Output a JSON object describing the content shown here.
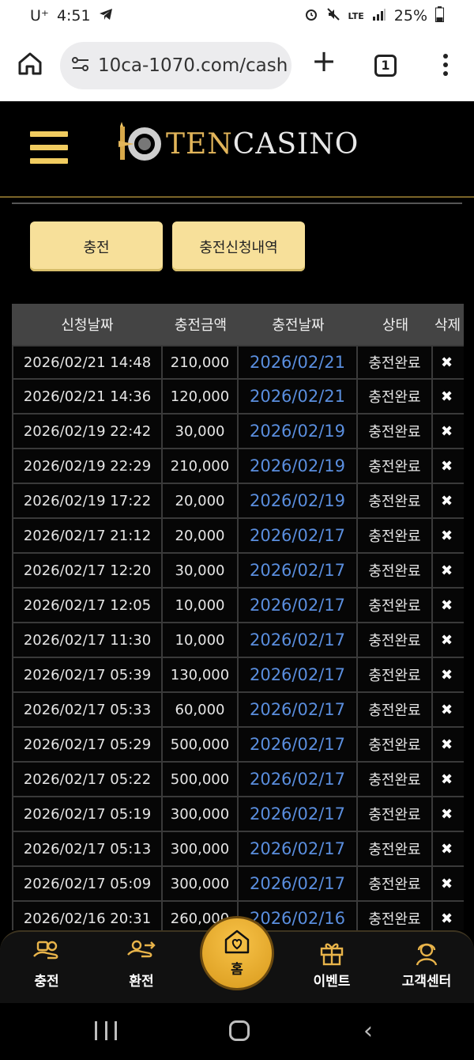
{
  "status_bar": {
    "carrier": "U⁺",
    "time": "4:51",
    "network": "LTE",
    "battery": "25%"
  },
  "browser": {
    "url": "10ca-1070.com/cash",
    "tab_count": "1"
  },
  "site": {
    "logo_ten": "TEN",
    "logo_casino": "CASINO"
  },
  "tabs": {
    "charge": "충전",
    "history": "충전신청내역"
  },
  "table": {
    "headers": [
      "신청날짜",
      "충전금액",
      "충전날짜",
      "상태",
      "삭제"
    ],
    "rows": [
      [
        "2026/02/21 14:48",
        "210,000",
        "2026/02/21",
        "충전완료",
        "✖"
      ],
      [
        "2026/02/21 14:36",
        "120,000",
        "2026/02/21",
        "충전완료",
        "✖"
      ],
      [
        "2026/02/19 22:42",
        "30,000",
        "2026/02/19",
        "충전완료",
        "✖"
      ],
      [
        "2026/02/19 22:29",
        "210,000",
        "2026/02/19",
        "충전완료",
        "✖"
      ],
      [
        "2026/02/19 17:22",
        "20,000",
        "2026/02/19",
        "충전완료",
        "✖"
      ],
      [
        "2026/02/17 21:12",
        "20,000",
        "2026/02/17",
        "충전완료",
        "✖"
      ],
      [
        "2026/02/17 12:20",
        "30,000",
        "2026/02/17",
        "충전완료",
        "✖"
      ],
      [
        "2026/02/17 12:05",
        "10,000",
        "2026/02/17",
        "충전완료",
        "✖"
      ],
      [
        "2026/02/17 11:30",
        "10,000",
        "2026/02/17",
        "충전완료",
        "✖"
      ],
      [
        "2026/02/17 05:39",
        "130,000",
        "2026/02/17",
        "충전완료",
        "✖"
      ],
      [
        "2026/02/17 05:33",
        "60,000",
        "2026/02/17",
        "충전완료",
        "✖"
      ],
      [
        "2026/02/17 05:29",
        "500,000",
        "2026/02/17",
        "충전완료",
        "✖"
      ],
      [
        "2026/02/17 05:22",
        "500,000",
        "2026/02/17",
        "충전완료",
        "✖"
      ],
      [
        "2026/02/17 05:19",
        "300,000",
        "2026/02/17",
        "충전완료",
        "✖"
      ],
      [
        "2026/02/17 05:13",
        "300,000",
        "2026/02/17",
        "충전완료",
        "✖"
      ],
      [
        "2026/02/17 05:09",
        "300,000",
        "2026/02/17",
        "충전완료",
        "✖"
      ],
      [
        "2026/02/16 20:31",
        "260,000",
        "2026/02/16",
        "충전완료",
        "✖"
      ]
    ]
  },
  "bottom_nav": {
    "charge": "충전",
    "withdraw": "환전",
    "home": "홈",
    "event": "이벤트",
    "support": "고객센터"
  },
  "colors": {
    "gold": "#f1cc60",
    "button_bg": "#f7e09a",
    "date_blue": "#5a8ede",
    "home_orange": "#e9a92b"
  }
}
